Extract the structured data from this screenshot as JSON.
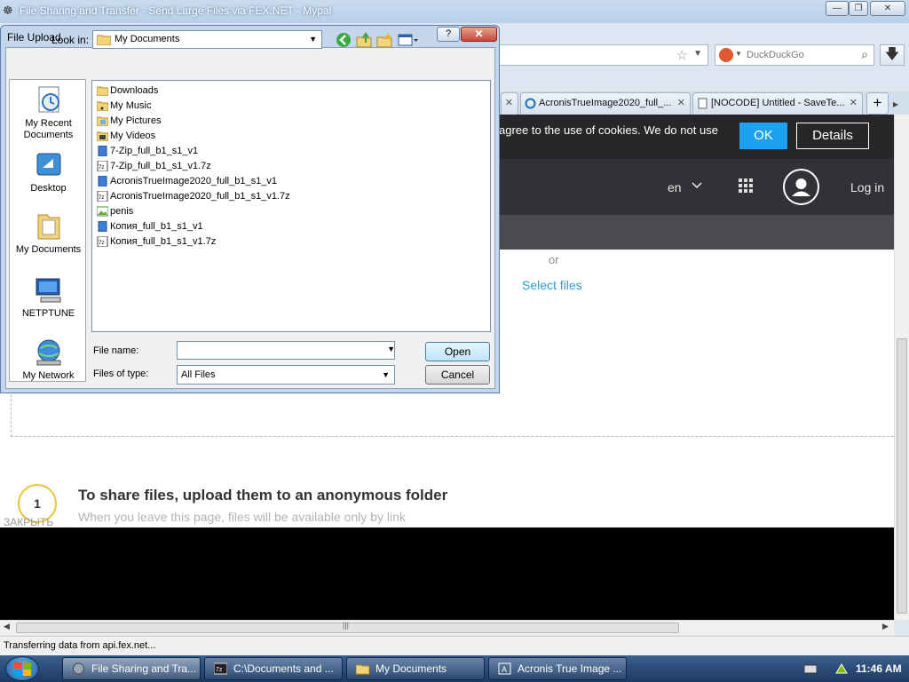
{
  "browser": {
    "window_title": "File Sharing and Transfer - Send Large Files via FEX.NET - Mypal",
    "search": {
      "placeholder": "DuckDuckGo"
    },
    "tabs": [
      {
        "label": "AcronisTrueImage2020_full_..."
      },
      {
        "label": "[NOCODE] Untitled - SaveTe..."
      }
    ],
    "status_text": "Transferring data from api.fex.net..."
  },
  "site": {
    "cookie_text": "agree to the use of cookies. We do not use",
    "cookie_ok": "OK",
    "cookie_details": "Details",
    "lang": "en",
    "login": "Log in",
    "or": "or",
    "select_files": "Select files",
    "step_number": "1",
    "step_title": "To share files, upload them to an anonymous folder",
    "step_subtitle": "When you leave this page, files will be available only by link",
    "close_label": "ЗАКРЫТЬ"
  },
  "dialog": {
    "title": "File Upload",
    "help": "?",
    "close": "✕",
    "look_in_label": "Look in:",
    "look_in_value": "My Documents",
    "places": [
      {
        "label": "My Recent Documents",
        "icon": "recent-documents-icon"
      },
      {
        "label": "Desktop",
        "icon": "desktop-icon"
      },
      {
        "label": "My Documents",
        "icon": "my-documents-icon"
      },
      {
        "label": "NETPTUNE",
        "icon": "computer-icon"
      },
      {
        "label": "My Network",
        "icon": "network-icon"
      }
    ],
    "files": [
      {
        "name": "Downloads",
        "type": "folder"
      },
      {
        "name": "My Music",
        "type": "folder"
      },
      {
        "name": "My Pictures",
        "type": "folder"
      },
      {
        "name": "My Videos",
        "type": "folder"
      },
      {
        "name": "7-Zip_full_b1_s1_v1",
        "type": "file"
      },
      {
        "name": "7-Zip_full_b1_s1_v1.7z",
        "type": "archive"
      },
      {
        "name": "AcronisTrueImage2020_full_b1_s1_v1",
        "type": "file"
      },
      {
        "name": "AcronisTrueImage2020_full_b1_s1_v1.7z",
        "type": "archive"
      },
      {
        "name": "penis",
        "type": "image"
      },
      {
        "name": "Копия_full_b1_s1_v1",
        "type": "file"
      },
      {
        "name": "Копия_full_b1_s1_v1.7z",
        "type": "archive"
      }
    ],
    "file_name_label": "File name:",
    "file_name_value": "",
    "files_of_type_label": "Files of type:",
    "files_of_type_value": "All Files",
    "open_label": "Open",
    "cancel_label": "Cancel"
  },
  "taskbar": {
    "items": [
      {
        "label": "File Sharing and Tra...",
        "active": true
      },
      {
        "label": "C:\\Documents and ...",
        "active": false
      },
      {
        "label": "My Documents",
        "active": false
      },
      {
        "label": "Acronis True Image ...",
        "active": false
      }
    ],
    "clock": "11:46 AM"
  },
  "colors": {
    "accent": "#1da1f2",
    "link": "#2a9fd6",
    "site_header": "#323236",
    "step_ring": "#f1c232"
  }
}
